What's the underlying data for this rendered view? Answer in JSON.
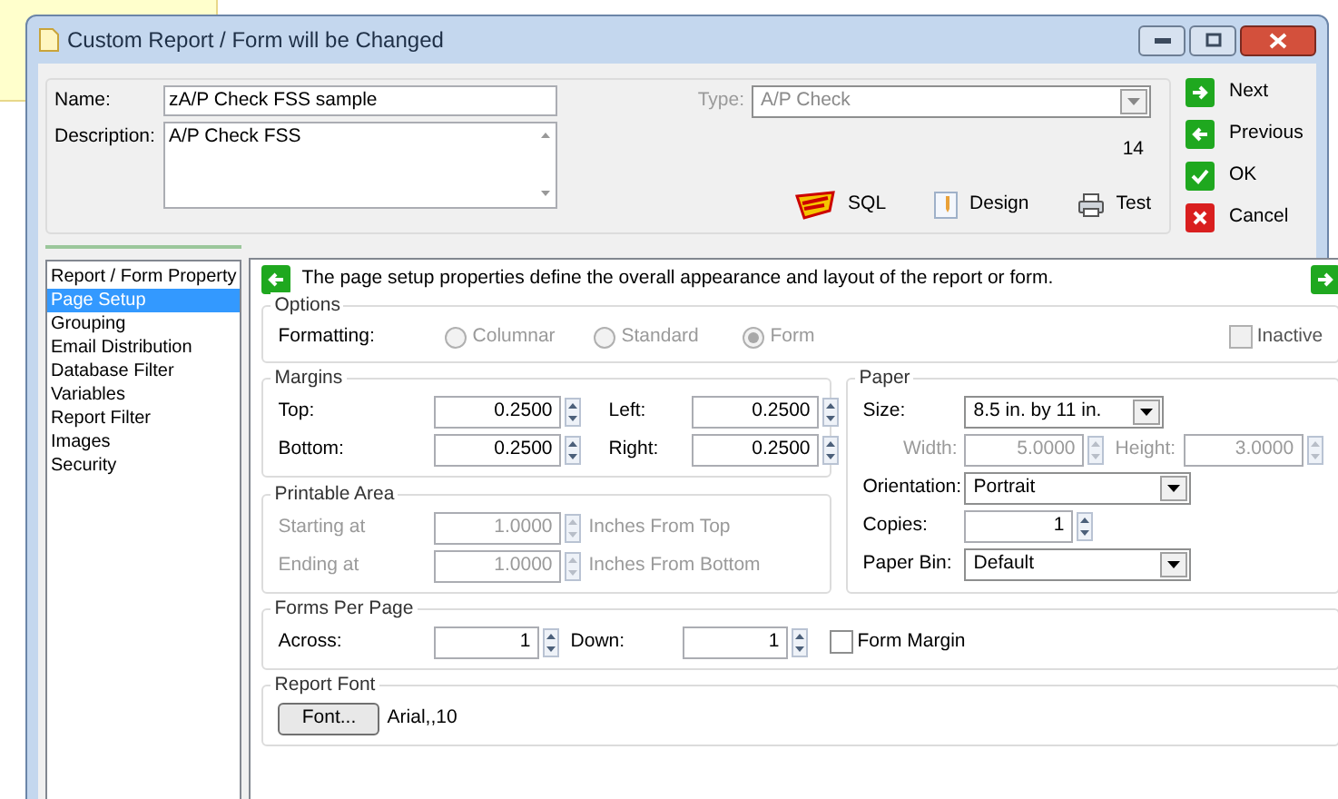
{
  "window": {
    "title": "Custom Report / Form will be Changed"
  },
  "header": {
    "name_label": "Name:",
    "name_value": "zA/P Check FSS sample",
    "description_label": "Description:",
    "description_value": "A/P Check FSS",
    "type_label": "Type:",
    "type_value": "A/P Check",
    "type_disabled": true,
    "count": "14",
    "tools": [
      {
        "kind": "sql",
        "label": "SQL"
      },
      {
        "kind": "design",
        "label": "Design"
      },
      {
        "kind": "test",
        "label": "Test"
      }
    ]
  },
  "actions": [
    {
      "kind": "next",
      "label": "Next"
    },
    {
      "kind": "previous",
      "label": "Previous"
    },
    {
      "kind": "ok",
      "label": "OK"
    },
    {
      "kind": "cancel",
      "label": "Cancel"
    }
  ],
  "sidebar": {
    "items": [
      {
        "label": "Report / Form Property",
        "selected": false
      },
      {
        "label": "Page Setup",
        "selected": true
      },
      {
        "label": "Grouping",
        "selected": false
      },
      {
        "label": "Email Distribution",
        "selected": false
      },
      {
        "label": "Database Filter",
        "selected": false
      },
      {
        "label": "Variables",
        "selected": false
      },
      {
        "label": "Report Filter",
        "selected": false
      },
      {
        "label": "Images",
        "selected": false
      },
      {
        "label": "Security",
        "selected": false
      }
    ]
  },
  "page": {
    "description": "The page setup properties define the overall appearance and layout of the report or form.",
    "options": {
      "title": "Options",
      "formatting_label": "Formatting:",
      "radios": [
        {
          "label": "Columnar",
          "selected": false
        },
        {
          "label": "Standard",
          "selected": false
        },
        {
          "label": "Form",
          "selected": true
        }
      ],
      "radios_disabled": true,
      "inactive": {
        "label": "Inactive",
        "checked": false,
        "disabled": true
      }
    },
    "margins": {
      "title": "Margins",
      "fields": [
        {
          "label": "Top:",
          "value": "0.2500"
        },
        {
          "label": "Left:",
          "value": "0.2500"
        },
        {
          "label": "Bottom:",
          "value": "0.2500"
        },
        {
          "label": "Right:",
          "value": "0.2500"
        }
      ]
    },
    "printable_area": {
      "title": "Printable Area",
      "rows": [
        {
          "label": "Starting at",
          "value": "1.0000",
          "unit": "Inches From Top",
          "disabled": true
        },
        {
          "label": "Ending at",
          "value": "1.0000",
          "unit": "Inches From Bottom",
          "disabled": true
        }
      ]
    },
    "paper": {
      "title": "Paper",
      "size_label": "Size:",
      "size_value": "8.5 in. by 11 in.",
      "width_label": "Width:",
      "width_value": "5.0000",
      "height_label": "Height:",
      "height_value": "3.0000",
      "dims_disabled": true,
      "orientation_label": "Orientation:",
      "orientation_value": "Portrait",
      "copies_label": "Copies:",
      "copies_value": "1",
      "bin_label": "Paper Bin:",
      "bin_value": "Default"
    },
    "forms_per_page": {
      "title": "Forms Per Page",
      "across_label": "Across:",
      "across_value": "1",
      "down_label": "Down:",
      "down_value": "1",
      "form_margin": {
        "label": "Form Margin",
        "checked": false
      }
    },
    "report_font": {
      "title": "Report Font",
      "button": "Font...",
      "value": "Arial,,10"
    }
  }
}
